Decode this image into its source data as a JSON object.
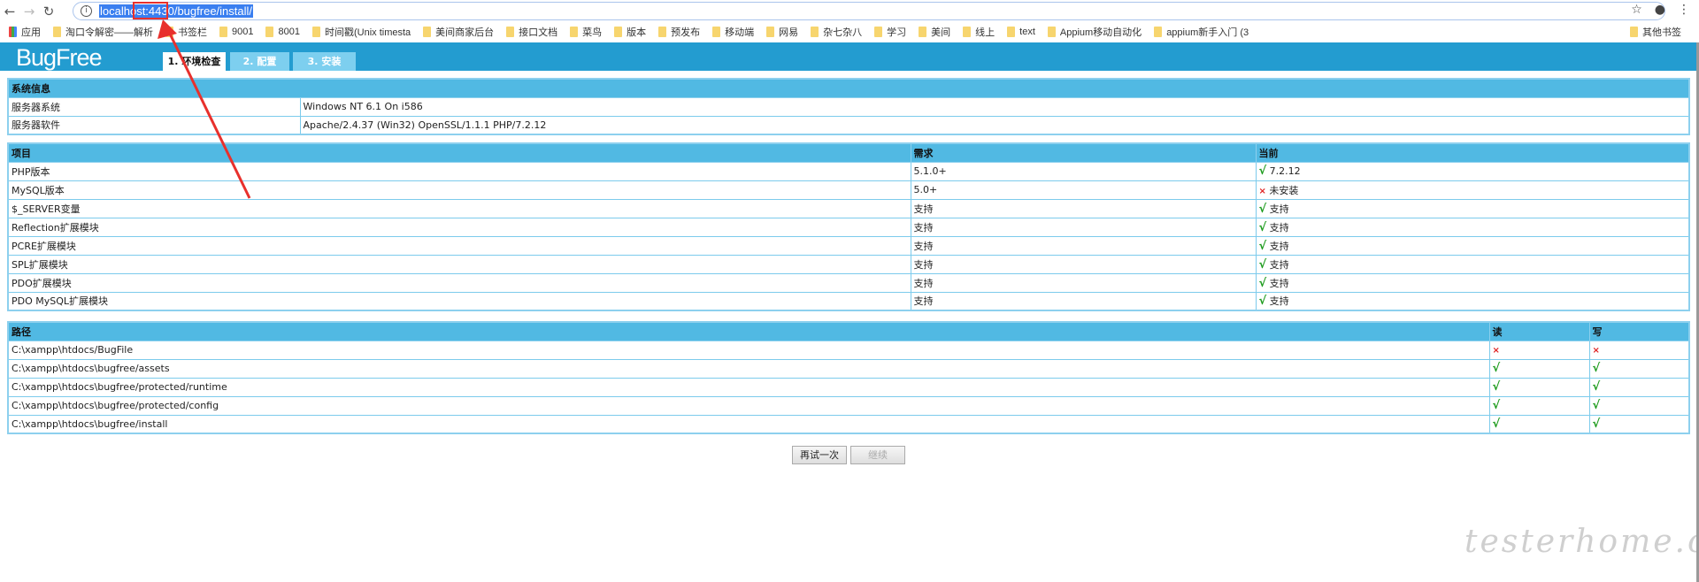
{
  "browser": {
    "url_highlight": "localhost:4430/bugfree/install/",
    "bookmarks": [
      "应用",
      "淘口令解密——解析",
      "书签栏",
      "9001",
      "8001",
      "时间戳(Unix timesta",
      "美间商家后台",
      "接口文档",
      "菜鸟",
      "版本",
      "预发布",
      "移动端",
      "网易",
      "杂七杂八",
      "学习",
      "美间",
      "线上",
      "text",
      "Appium移动自动化",
      "appium新手入门 (3"
    ],
    "other_bookmarks": "其他书签"
  },
  "app": {
    "logo": "BugFree",
    "tabs": [
      {
        "label": "1. 环境检查",
        "active": true
      },
      {
        "label": "2. 配置",
        "active": false
      },
      {
        "label": "3. 安装",
        "active": false
      }
    ]
  },
  "sysinfo": {
    "title": "系统信息",
    "rows": [
      [
        "服务器系统",
        "Windows NT 6.1 On i586"
      ],
      [
        "服务器软件",
        "Apache/2.4.37 (Win32) OpenSSL/1.1.1 PHP/7.2.12"
      ]
    ]
  },
  "requirements": {
    "headers": [
      "项目",
      "需求",
      "当前"
    ],
    "rows": [
      {
        "item": "PHP版本",
        "need": "5.1.0+",
        "ok": true,
        "current": "7.2.12"
      },
      {
        "item": "MySQL版本",
        "need": "5.0+",
        "ok": false,
        "current": "未安装"
      },
      {
        "item": "$_SERVER变量",
        "need": "支持",
        "ok": true,
        "current": "支持"
      },
      {
        "item": "Reflection扩展模块",
        "need": "支持",
        "ok": true,
        "current": "支持"
      },
      {
        "item": "PCRE扩展模块",
        "need": "支持",
        "ok": true,
        "current": "支持"
      },
      {
        "item": "SPL扩展模块",
        "need": "支持",
        "ok": true,
        "current": "支持"
      },
      {
        "item": "PDO扩展模块",
        "need": "支持",
        "ok": true,
        "current": "支持"
      },
      {
        "item": "PDO MySQL扩展模块",
        "need": "支持",
        "ok": true,
        "current": "支持"
      }
    ]
  },
  "paths": {
    "headers": [
      "路径",
      "读",
      "写"
    ],
    "rows": [
      {
        "path": "C:\\xampp\\htdocs/BugFile",
        "read": false,
        "write": false
      },
      {
        "path": "C:\\xampp\\htdocs\\bugfree/assets",
        "read": true,
        "write": true
      },
      {
        "path": "C:\\xampp\\htdocs\\bugfree/protected/runtime",
        "read": true,
        "write": true
      },
      {
        "path": "C:\\xampp\\htdocs\\bugfree/protected/config",
        "read": true,
        "write": true
      },
      {
        "path": "C:\\xampp\\htdocs\\bugfree/install",
        "read": true,
        "write": true
      }
    ]
  },
  "symbols": {
    "ok": "√",
    "bad": "×"
  },
  "buttons": {
    "retry": "再试一次",
    "continue": "继续"
  },
  "watermark": "testerhome.com"
}
